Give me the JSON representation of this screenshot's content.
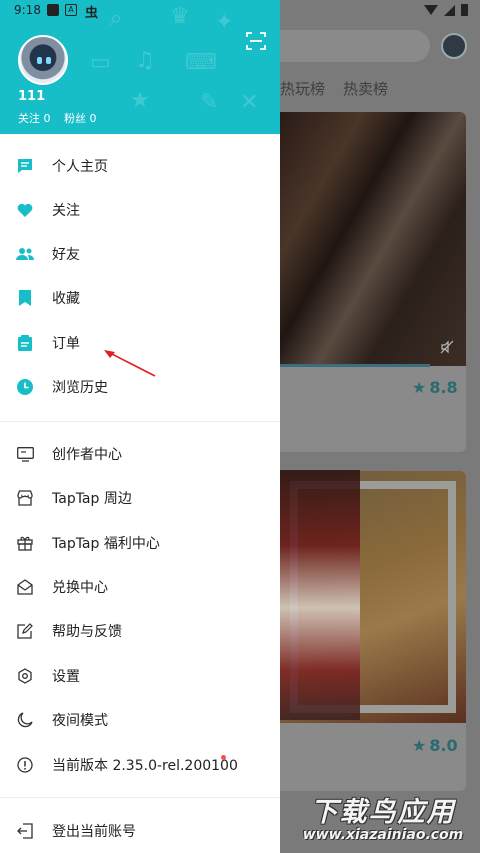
{
  "status_bar": {
    "time": "9:18",
    "carrier_glyph": "虫",
    "box_glyph": "A"
  },
  "drawer": {
    "username": "111",
    "following_label": "关注 0",
    "followers_label": "粉丝 0",
    "accent_color": "#17bec8",
    "menu_primary": [
      {
        "id": "homepage",
        "label": "个人主页",
        "icon": "message-square-icon"
      },
      {
        "id": "follow",
        "label": "关注",
        "icon": "heart-icon"
      },
      {
        "id": "friends",
        "label": "好友",
        "icon": "people-icon"
      },
      {
        "id": "favorites",
        "label": "收藏",
        "icon": "bookmark-icon"
      },
      {
        "id": "orders",
        "label": "订单",
        "icon": "clipboard-icon"
      },
      {
        "id": "history",
        "label": "浏览历史",
        "icon": "clock-icon"
      }
    ],
    "menu_secondary": [
      {
        "id": "creator",
        "label": "创作者中心",
        "icon": "monitor-icon"
      },
      {
        "id": "merch",
        "label": "TapTap 周边",
        "icon": "store-icon"
      },
      {
        "id": "welfare",
        "label": "TapTap 福利中心",
        "icon": "gift-icon"
      },
      {
        "id": "redeem",
        "label": "兑换中心",
        "icon": "envelope-open-icon"
      },
      {
        "id": "help",
        "label": "帮助与反馈",
        "icon": "edit-icon"
      },
      {
        "id": "settings",
        "label": "设置",
        "icon": "hexagon-settings-icon"
      },
      {
        "id": "night",
        "label": "夜间模式",
        "icon": "moon-icon"
      },
      {
        "id": "version",
        "label": "当前版本 2.35.0-rel.200100",
        "icon": "info-circle-icon"
      }
    ],
    "logout_label": "登出当前账号"
  },
  "background": {
    "tabs": [
      "热玩榜",
      "热卖榜"
    ],
    "ratings": [
      "8.8",
      "8.0"
    ]
  },
  "watermark": {
    "title": "下载鸟应用",
    "url": "www.xiazainiao.com"
  }
}
